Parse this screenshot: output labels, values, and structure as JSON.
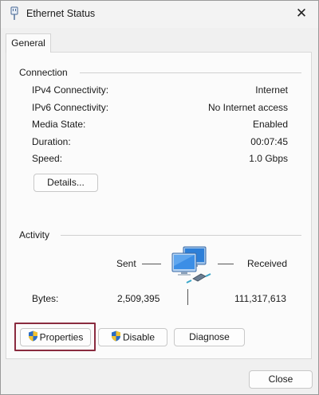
{
  "window": {
    "title": "Ethernet Status",
    "close_glyph": "✕"
  },
  "tabs": [
    {
      "label": "General"
    }
  ],
  "connection": {
    "header": "Connection",
    "rows": [
      {
        "label": "IPv4 Connectivity:",
        "value": "Internet"
      },
      {
        "label": "IPv6 Connectivity:",
        "value": "No Internet access"
      },
      {
        "label": "Media State:",
        "value": "Enabled"
      },
      {
        "label": "Duration:",
        "value": "00:07:45"
      },
      {
        "label": "Speed:",
        "value": "1.0 Gbps"
      }
    ],
    "details_button": "Details..."
  },
  "activity": {
    "header": "Activity",
    "sent_label": "Sent",
    "received_label": "Received",
    "bytes_label": "Bytes:",
    "bytes_sent": "2,509,395",
    "bytes_received": "111,317,613"
  },
  "actions": {
    "properties": "Properties",
    "disable": "Disable",
    "diagnose": "Diagnose"
  },
  "footer": {
    "close": "Close"
  },
  "icons": {
    "title": "ethernet-adapter-icon",
    "network": "network-computers-icon",
    "shield": "uac-shield-icon"
  },
  "colors": {
    "highlight_border": "#8a2b3f",
    "shield_blue": "#2b6cc4",
    "shield_yellow": "#f2c230"
  }
}
